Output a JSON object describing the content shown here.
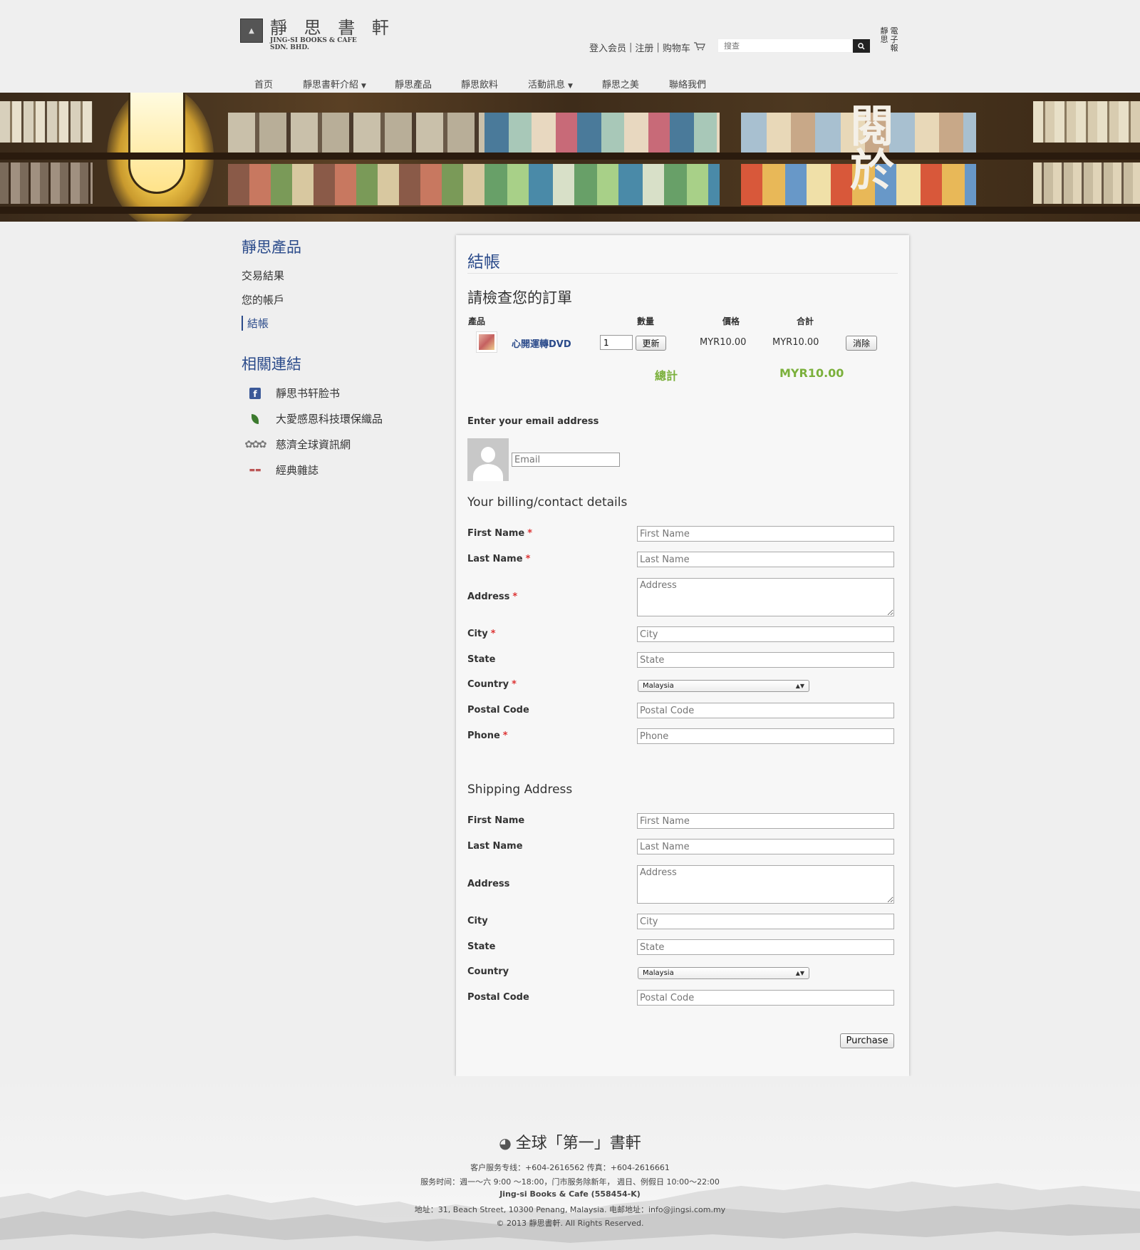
{
  "header": {
    "logo_cn": "靜 思 書 軒",
    "logo_en_1": "JING-SI BOOKS & CAFE",
    "logo_en_2": "SDN. BHD.",
    "top_links": [
      "登入会员",
      "注册",
      "购物车"
    ],
    "search_placeholder": "搜查",
    "ebook_chars": [
      "電子報",
      "靜思"
    ]
  },
  "nav": {
    "items": [
      {
        "label": "首页",
        "dropdown": false
      },
      {
        "label": "靜思書軒介紹",
        "dropdown": true
      },
      {
        "label": "靜思產品",
        "dropdown": false
      },
      {
        "label": "靜思飲料",
        "dropdown": false
      },
      {
        "label": "活動訊息",
        "dropdown": true
      },
      {
        "label": "靜思之美",
        "dropdown": false
      },
      {
        "label": "聯絡我們",
        "dropdown": false
      }
    ]
  },
  "banner": {
    "calligraphy": "閱於"
  },
  "sidebar": {
    "title": "靜思產品",
    "links": [
      "交易結果",
      "您的帳戶",
      "結帳"
    ],
    "related_title": "相關連結",
    "related": [
      "靜思书轩脸书",
      "大愛感恩科技環保織品",
      "慈濟全球資訊網",
      "經典雜誌"
    ]
  },
  "checkout": {
    "title": "結帳",
    "review_heading": "請檢查您的訂單",
    "columns": [
      "產品",
      "數量",
      "價格",
      "合計"
    ],
    "item": {
      "name": "心開運轉DVD",
      "quantity": "1",
      "update_label": "更新",
      "price": "MYR10.00",
      "subtotal": "MYR10.00",
      "remove_label": "消除"
    },
    "total_label": "總計",
    "total_value": "MYR10.00",
    "email_heading": "Enter your email address",
    "email_placeholder": "Email",
    "billing_heading": "Your billing/contact details",
    "billing": {
      "first_name": "First Name",
      "last_name": "Last Name",
      "address": "Address",
      "city": "City",
      "state": "State",
      "country": "Country",
      "postal_code": "Postal Code",
      "phone": "Phone"
    },
    "country_value": "Malaysia",
    "shipping_heading": "Shipping Address",
    "purchase_label": "Purchase"
  },
  "footer": {
    "title": "全球「第一」書軒",
    "lines": [
      "客户服务专线：+604-2616562  传真：+604-2616661",
      "服务时间：週一～六 9:00 ～18:00，门市服务除新年， 週日、例假日 10:00～22:00",
      "Jing-si Books & Cafe (558454-K)",
      "地址：31, Beach Street, 10300 Penang, Malaysia. 电邮地址：info@jingsi.com.my",
      "© 2013 靜思書軒. All Rights Reserved."
    ]
  },
  "colors": {
    "accent": "#2a4a8a",
    "total_green": "#7bb03c",
    "required": "#d33333"
  }
}
